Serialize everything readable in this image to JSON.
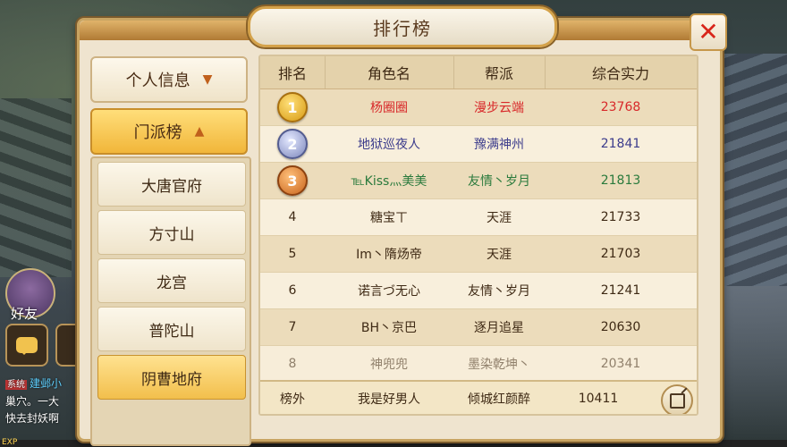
{
  "window": {
    "title": "排行榜"
  },
  "menu": {
    "personal": {
      "label": "个人信息",
      "icon": "chevron-down-icon"
    },
    "sect": {
      "label": "门派榜",
      "icon": "chevron-up-icon"
    },
    "sects": [
      "大唐官府",
      "方寸山",
      "龙宫",
      "普陀山",
      "阴曹地府"
    ],
    "active_sect": "阴曹地府"
  },
  "table": {
    "headers": [
      "排名",
      "角色名",
      "帮派",
      "综合实力"
    ],
    "rows": [
      {
        "rank": "1",
        "name": "杨圈圈",
        "guild": "漫步云端",
        "power": "23768"
      },
      {
        "rank": "2",
        "name": "地狱巡夜人",
        "guild": "豫满神州",
        "power": "21841"
      },
      {
        "rank": "3",
        "name": "℡Kiss灬美美",
        "guild": "友情丶岁月",
        "power": "21813"
      },
      {
        "rank": "4",
        "name": "糖宝ㄒ",
        "guild": "天涯",
        "power": "21733"
      },
      {
        "rank": "5",
        "name": "Im丶隋炀帝",
        "guild": "天涯",
        "power": "21703"
      },
      {
        "rank": "6",
        "name": "诺言づ无心",
        "guild": "友情丶岁月",
        "power": "21241"
      },
      {
        "rank": "7",
        "name": "BH丶京巴",
        "guild": "逐月追星",
        "power": "20630"
      },
      {
        "rank": "8",
        "name": "神兜兜",
        "guild": "墨染乾坤丶",
        "power": "20341"
      }
    ],
    "mine": {
      "rank": "榜外",
      "name": "我是好男人",
      "guild": "倾城红颜醉",
      "power": "10411"
    }
  },
  "overlay": {
    "friend_label": "好友",
    "chat_tag": "系统",
    "chat_lines": [
      "建邺小",
      "巢穴。一大",
      "快去封妖啊"
    ],
    "exp_label": "EXP"
  },
  "colors": {
    "gold": "#d79a12",
    "silver": "#7c86bb",
    "bronze": "#c8641c",
    "rank1": "#d8282a",
    "rank2": "#3c3c8c",
    "rank3": "#2a7a3c"
  }
}
